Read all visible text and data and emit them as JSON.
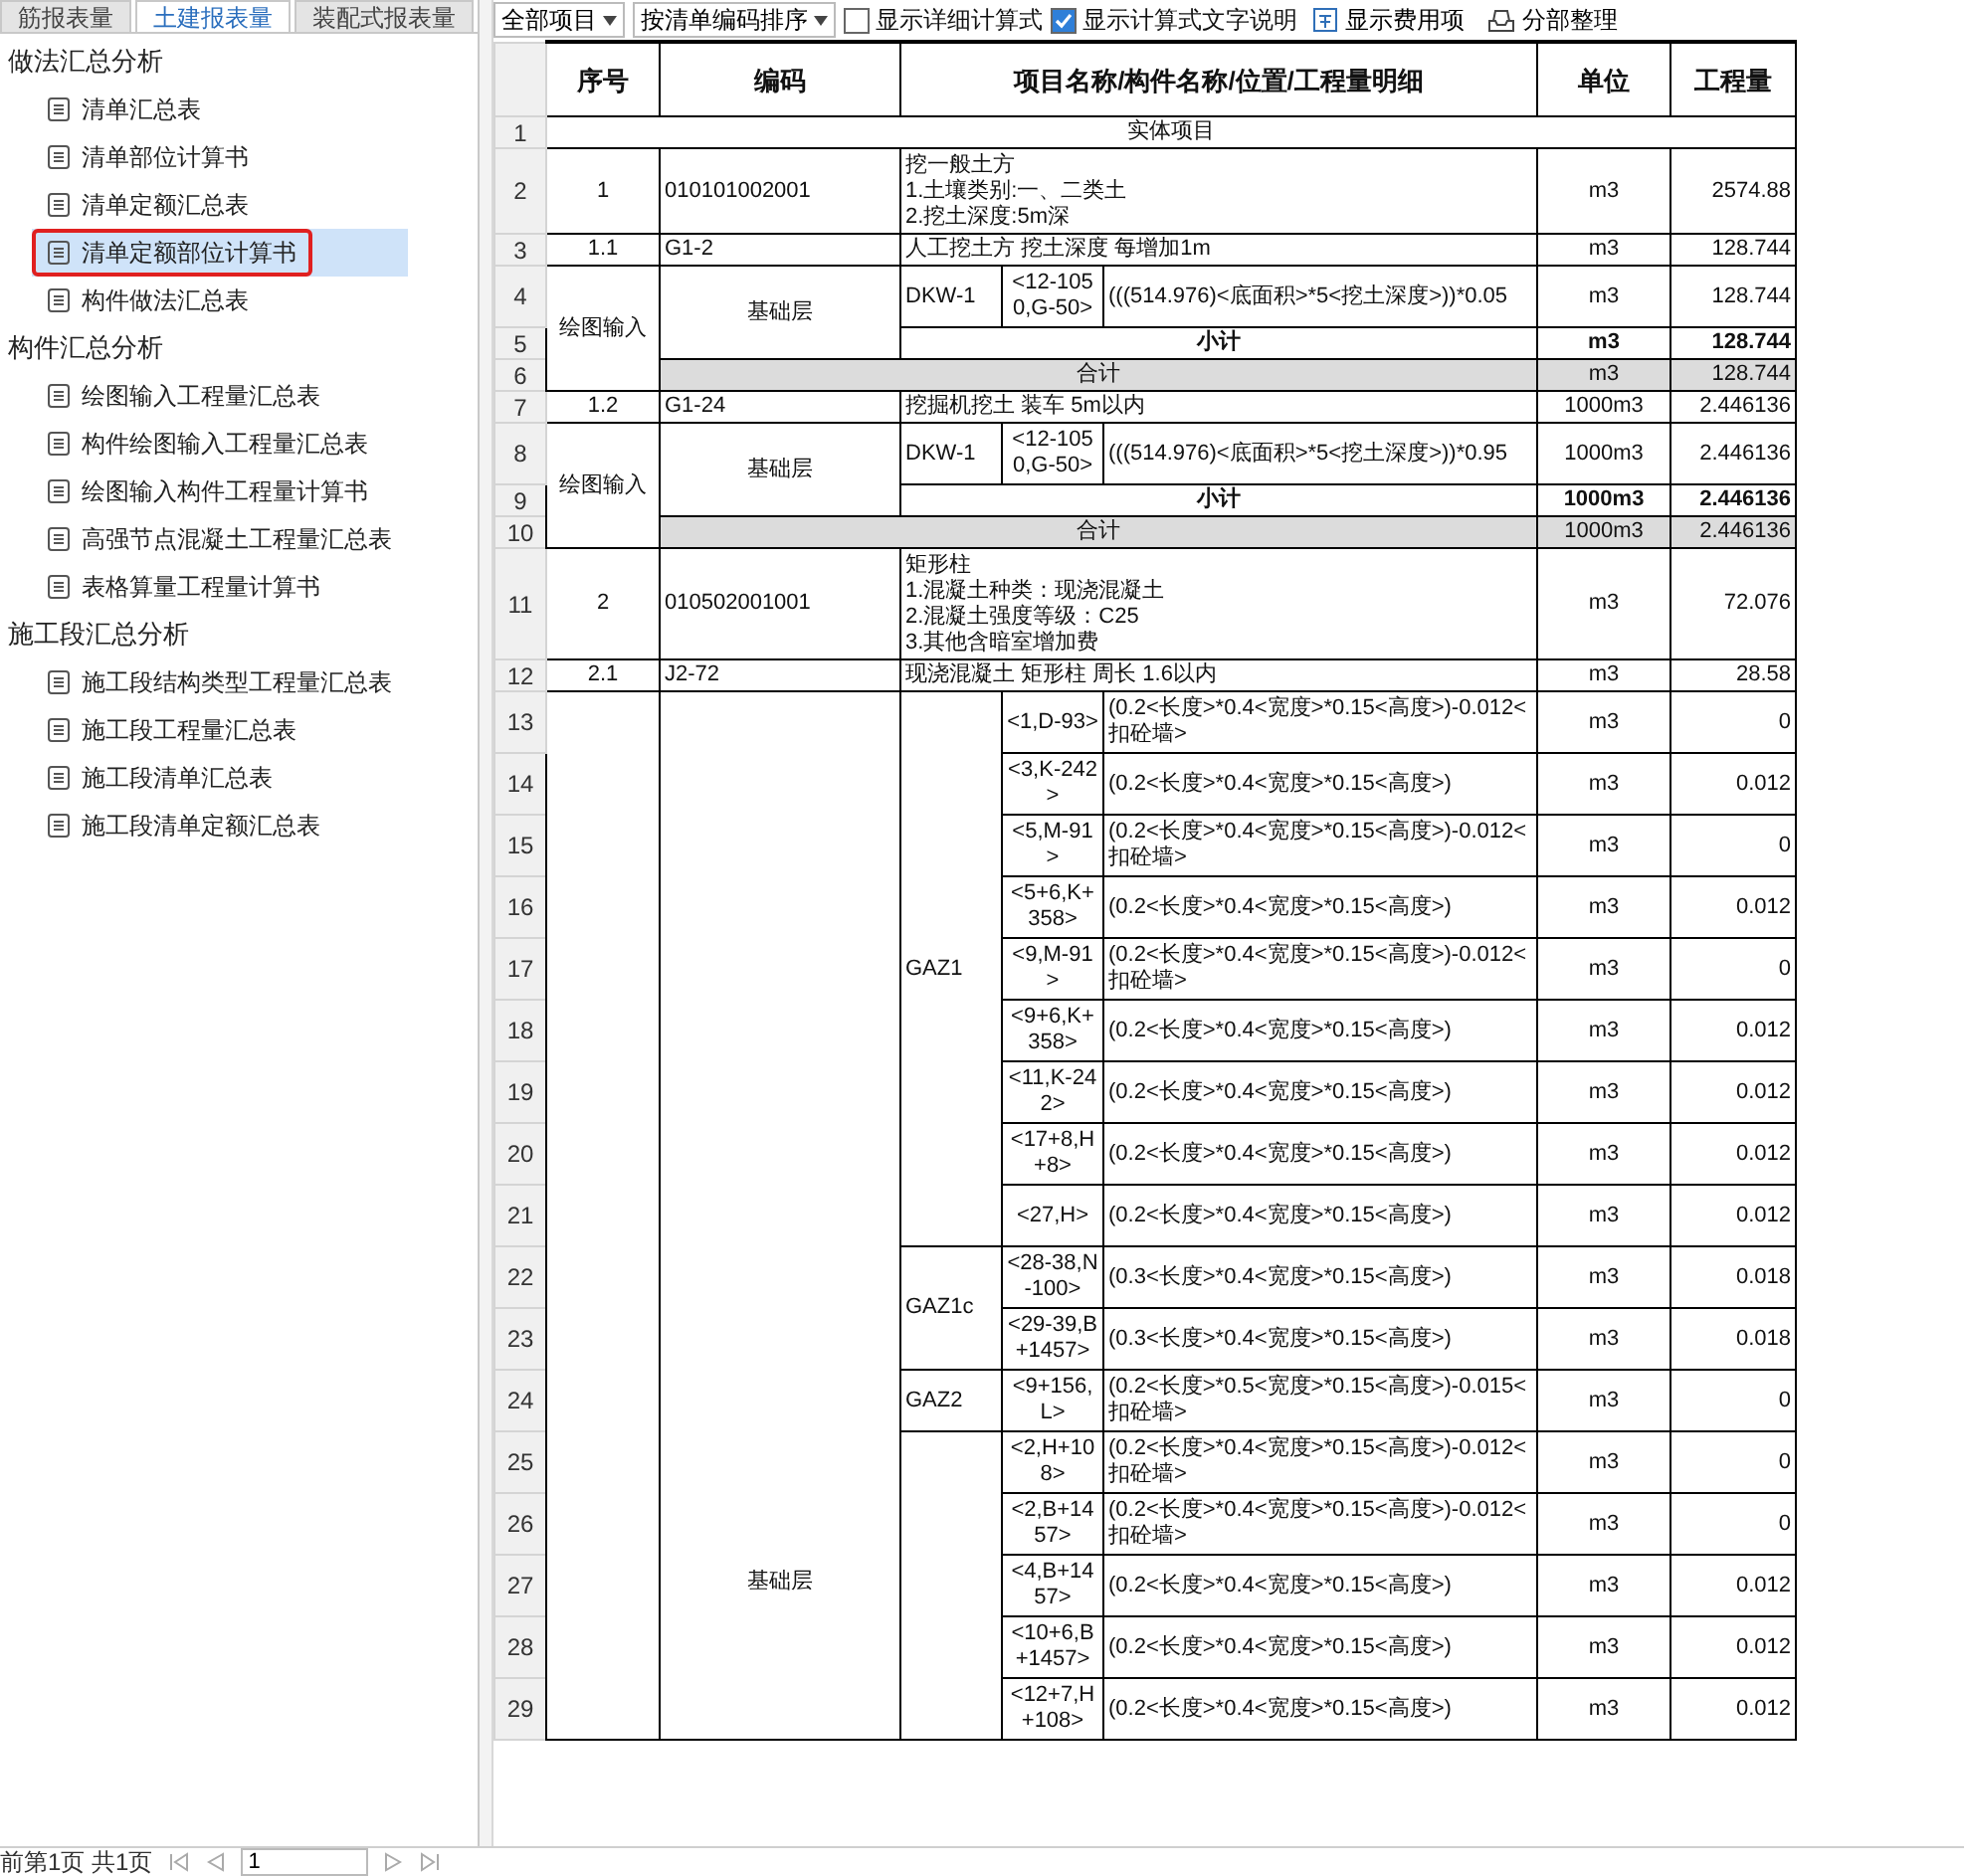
{
  "sidebar": {
    "tabs": [
      {
        "label": "筋报表量",
        "selected": false
      },
      {
        "label": "土建报表量",
        "selected": true
      },
      {
        "label": "装配式报表量",
        "selected": false
      }
    ],
    "groups": [
      {
        "title": "做法汇总分析",
        "items": [
          {
            "label": "清单汇总表",
            "selected": false
          },
          {
            "label": "清单部位计算书",
            "selected": false
          },
          {
            "label": "清单定额汇总表",
            "selected": false
          },
          {
            "label": "清单定额部位计算书",
            "selected": true
          },
          {
            "label": "构件做法汇总表",
            "selected": false
          }
        ]
      },
      {
        "title": "构件汇总分析",
        "items": [
          {
            "label": "绘图输入工程量汇总表",
            "selected": false
          },
          {
            "label": "构件绘图输入工程量汇总表",
            "selected": false
          },
          {
            "label": "绘图输入构件工程量计算书",
            "selected": false
          },
          {
            "label": "高强节点混凝土工程量汇总表",
            "selected": false
          },
          {
            "label": "表格算量工程量计算书",
            "selected": false
          }
        ]
      },
      {
        "title": "施工段汇总分析",
        "items": [
          {
            "label": "施工段结构类型工程量汇总表",
            "selected": false
          },
          {
            "label": "施工段工程量汇总表",
            "selected": false
          },
          {
            "label": "施工段清单汇总表",
            "selected": false
          },
          {
            "label": "施工段清单定额汇总表",
            "selected": false
          }
        ]
      }
    ]
  },
  "toolbar": {
    "scope": "全部项目",
    "sort": "按清单编码排序",
    "options": [
      {
        "label": "显示详细计算式",
        "checked": false
      },
      {
        "label": "显示计算式文字说明",
        "checked": true
      }
    ],
    "actions": [
      {
        "kind": "fees",
        "label": "显示费用项"
      },
      {
        "kind": "organize",
        "label": "分部整理"
      }
    ]
  },
  "table": {
    "columns": [
      "序号",
      "编码",
      "项目名称/构件名称/位置/工程量明细",
      "单位",
      "工程量"
    ],
    "section": {
      "row": "1",
      "label": "实体项目"
    },
    "items": [
      {
        "row": "2",
        "seq": "1",
        "code": "010101002001",
        "lines": [
          "挖一般土方",
          "1.土壤类别:一、二类土",
          "2.挖土深度:5m深"
        ],
        "unit": "m3",
        "quantity": "2574.88",
        "sub_items": [
          {
            "row": "3",
            "seq": "1.1",
            "code": "G1-2",
            "name": "人工挖土方 挖土深度 每增加1m",
            "unit": "m3",
            "quantity": "128.744",
            "sources": [
              {
                "input": "绘图输入",
                "floors": [
                  {
                    "floor": "基础层",
                    "components": [
                      {
                        "name": "DKW-1",
                        "locations": [
                          {
                            "row": "4",
                            "position": "<12-1050,G-50>",
                            "formula": "(((514.976)<底面积>*5<挖土深度>))*0.05",
                            "unit": "m3",
                            "quantity": "128.744"
                          }
                        ]
                      }
                    ],
                    "subtotal": {
                      "row": "5",
                      "label": "小计",
                      "unit": "m3",
                      "quantity": "128.744"
                    }
                  }
                ],
                "total": {
                  "row": "6",
                  "label": "合计",
                  "unit": "m3",
                  "quantity": "128.744"
                }
              }
            ]
          },
          {
            "row": "7",
            "seq": "1.2",
            "code": "G1-24",
            "name": "挖掘机挖土 装车 5m以内",
            "unit": "1000m3",
            "quantity": "2.446136",
            "sources": [
              {
                "input": "绘图输入",
                "floors": [
                  {
                    "floor": "基础层",
                    "components": [
                      {
                        "name": "DKW-1",
                        "locations": [
                          {
                            "row": "8",
                            "position": "<12-1050,G-50>",
                            "formula": "(((514.976)<底面积>*5<挖土深度>))*0.95",
                            "unit": "1000m3",
                            "quantity": "2.446136"
                          }
                        ]
                      }
                    ],
                    "subtotal": {
                      "row": "9",
                      "label": "小计",
                      "unit": "1000m3",
                      "quantity": "2.446136"
                    }
                  }
                ],
                "total": {
                  "row": "10",
                  "label": "合计",
                  "unit": "1000m3",
                  "quantity": "2.446136"
                }
              }
            ]
          }
        ]
      },
      {
        "row": "11",
        "seq": "2",
        "code": "010502001001",
        "lines": [
          "矩形柱",
          "1.混凝土种类：现浇混凝土",
          "2.混凝土强度等级：C25",
          "3.其他含暗室增加费"
        ],
        "unit": "m3",
        "quantity": "72.076",
        "sub_items": [
          {
            "row": "12",
            "seq": "2.1",
            "code": "J2-72",
            "name": "现浇混凝土 矩形柱 周长 1.6以内",
            "unit": "m3",
            "quantity": "28.58",
            "sources": [
              {
                "floors": [
                  {
                    "floor": "基础层",
                    "components": [
                      {
                        "name": "GAZ1",
                        "locations": [
                          {
                            "row": "13",
                            "position": "<1,D-93>",
                            "formula": "(0.2<长度>*0.4<宽度>*0.15<高度>)-0.012<扣砼墙>",
                            "unit": "m3",
                            "quantity": "0"
                          },
                          {
                            "row": "14",
                            "position": "<3,K-242>",
                            "formula": "(0.2<长度>*0.4<宽度>*0.15<高度>)",
                            "unit": "m3",
                            "quantity": "0.012"
                          },
                          {
                            "row": "15",
                            "position": "<5,M-91>",
                            "formula": "(0.2<长度>*0.4<宽度>*0.15<高度>)-0.012<扣砼墙>",
                            "unit": "m3",
                            "quantity": "0"
                          },
                          {
                            "row": "16",
                            "position": "<5+6,K+358>",
                            "formula": "(0.2<长度>*0.4<宽度>*0.15<高度>)",
                            "unit": "m3",
                            "quantity": "0.012"
                          },
                          {
                            "row": "17",
                            "position": "<9,M-91>",
                            "formula": "(0.2<长度>*0.4<宽度>*0.15<高度>)-0.012<扣砼墙>",
                            "unit": "m3",
                            "quantity": "0"
                          },
                          {
                            "row": "18",
                            "position": "<9+6,K+358>",
                            "formula": "(0.2<长度>*0.4<宽度>*0.15<高度>)",
                            "unit": "m3",
                            "quantity": "0.012"
                          },
                          {
                            "row": "19",
                            "position": "<11,K-242>",
                            "formula": "(0.2<长度>*0.4<宽度>*0.15<高度>)",
                            "unit": "m3",
                            "quantity": "0.012"
                          },
                          {
                            "row": "20",
                            "position": "<17+8,H+8>",
                            "formula": "(0.2<长度>*0.4<宽度>*0.15<高度>)",
                            "unit": "m3",
                            "quantity": "0.012"
                          },
                          {
                            "row": "21",
                            "position": "<27,H>",
                            "formula": "(0.2<长度>*0.4<宽度>*0.15<高度>)",
                            "unit": "m3",
                            "quantity": "0.012"
                          }
                        ]
                      },
                      {
                        "name": "GAZ1c",
                        "locations": [
                          {
                            "row": "22",
                            "position": "<28-38,N-100>",
                            "formula": "(0.3<长度>*0.4<宽度>*0.15<高度>)",
                            "unit": "m3",
                            "quantity": "0.018"
                          },
                          {
                            "row": "23",
                            "position": "<29-39,B+1457>",
                            "formula": "(0.3<长度>*0.4<宽度>*0.15<高度>)",
                            "unit": "m3",
                            "quantity": "0.018"
                          }
                        ]
                      },
                      {
                        "name": "GAZ2",
                        "locations": [
                          {
                            "row": "24",
                            "position": "<9+156,L>",
                            "formula": "(0.2<长度>*0.5<宽度>*0.15<高度>)-0.015<扣砼墙>",
                            "unit": "m3",
                            "quantity": "0"
                          }
                        ]
                      },
                      {
                        "locations": [
                          {
                            "row": "25",
                            "position": "<2,H+108>",
                            "formula": "(0.2<长度>*0.4<宽度>*0.15<高度>)-0.012<扣砼墙>",
                            "unit": "m3",
                            "quantity": "0"
                          },
                          {
                            "row": "26",
                            "position": "<2,B+1457>",
                            "formula": "(0.2<长度>*0.4<宽度>*0.15<高度>)-0.012<扣砼墙>",
                            "unit": "m3",
                            "quantity": "0"
                          },
                          {
                            "row": "27",
                            "position": "<4,B+1457>",
                            "formula": "(0.2<长度>*0.4<宽度>*0.15<高度>)",
                            "unit": "m3",
                            "quantity": "0.012"
                          },
                          {
                            "row": "28",
                            "position": "<10+6,B+1457>",
                            "formula": "(0.2<长度>*0.4<宽度>*0.15<高度>)",
                            "unit": "m3",
                            "quantity": "0.012"
                          },
                          {
                            "row": "29",
                            "position": "<12+7,H+108>",
                            "formula": "(0.2<长度>*0.4<宽度>*0.15<高度>)",
                            "unit": "m3",
                            "quantity": "0.012"
                          }
                        ]
                      }
                    ]
                  }
                ]
              }
            ]
          }
        ]
      }
    ]
  },
  "pager": {
    "status": "前第1页  共1页",
    "page": "1"
  }
}
